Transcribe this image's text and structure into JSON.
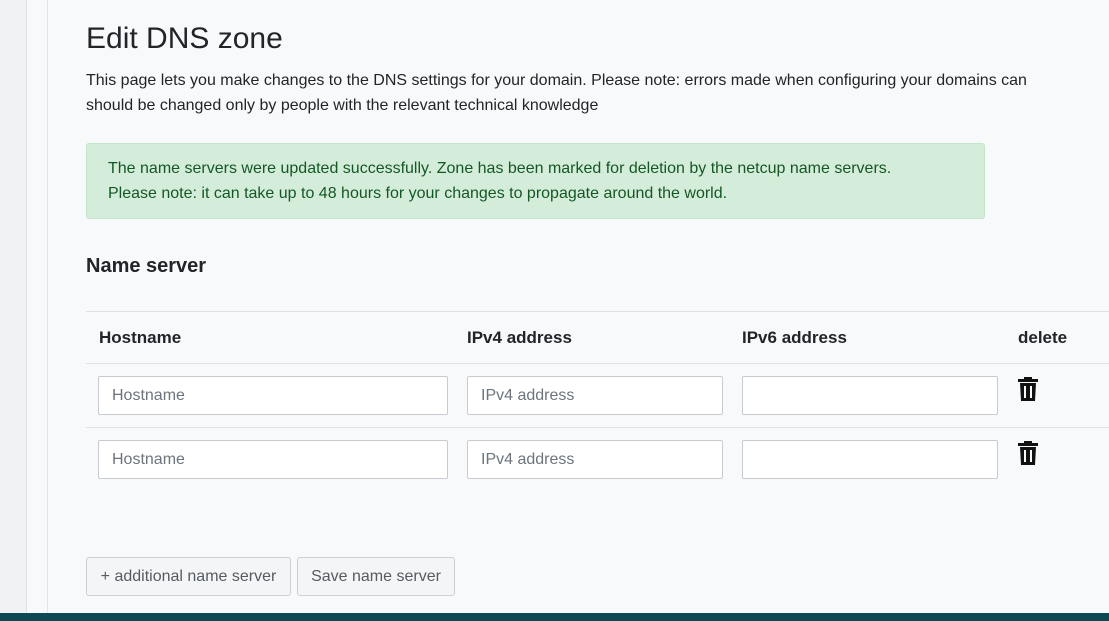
{
  "page": {
    "title": "Edit DNS zone",
    "intro_line1": "This page lets you make changes to the DNS settings for your domain. Please note: errors made when configuring your domains can",
    "intro_line2": "should be changed only by people with the relevant technical knowledge"
  },
  "alert": {
    "line1": "The name servers were updated successfully. Zone has been marked for deletion by the netcup name servers.",
    "line2": "Please note: it can take up to 48 hours for your changes to propagate around the world."
  },
  "nameserver": {
    "section_title": "Name server",
    "columns": [
      "Hostname",
      "IPv4 address",
      "IPv6 address",
      "delete"
    ],
    "rows": [
      {
        "hostname_placeholder": "Hostname",
        "hostname_value": "",
        "ipv4_placeholder": "IPv4 address",
        "ipv4_value": "",
        "ipv6_placeholder": "",
        "ipv6_value": ""
      },
      {
        "hostname_placeholder": "Hostname",
        "hostname_value": "",
        "ipv4_placeholder": "IPv4 address",
        "ipv4_value": "",
        "ipv6_placeholder": "",
        "ipv6_value": ""
      }
    ],
    "delete_icon": "trash-icon",
    "add_button": "+ additional name server",
    "save_button": "Save name server"
  },
  "colors": {
    "alert_bg": "#d4edda",
    "alert_text": "#155724",
    "footer": "#0b4a52"
  }
}
